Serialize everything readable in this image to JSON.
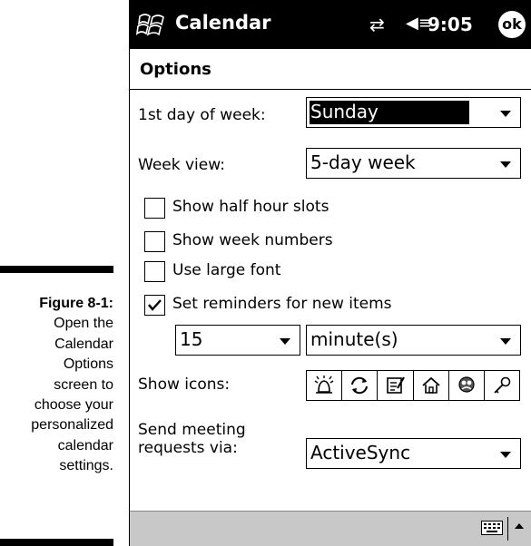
{
  "caption": {
    "figure_label": "Figure 8-1:",
    "lines": [
      "Open the",
      "Calendar",
      "Options",
      "screen to",
      "choose your",
      "personalized",
      "calendar",
      "settings."
    ]
  },
  "titlebar": {
    "app_title": "Calendar",
    "time": "9:05",
    "ok_label": "ok",
    "icons": [
      "windows-start-icon",
      "connectivity-icon",
      "speaker-icon"
    ]
  },
  "page": {
    "title": "Options"
  },
  "fields": {
    "first_day": {
      "label": "1st day of week:",
      "value": "Sunday"
    },
    "week_view": {
      "label": "Week view:",
      "value": "5-day week"
    }
  },
  "checkboxes": [
    {
      "label": "Show half hour slots",
      "checked": false
    },
    {
      "label": "Show week numbers",
      "checked": false
    },
    {
      "label": "Use large font",
      "checked": false
    },
    {
      "label": "Set reminders for new items",
      "checked": true
    }
  ],
  "reminder": {
    "amount": "15",
    "unit": "minute(s)"
  },
  "show_icons": {
    "label": "Show icons:",
    "icons": [
      "alarm-icon",
      "recurrence-icon",
      "note-icon",
      "home-icon",
      "meeting-icon",
      "key-icon"
    ]
  },
  "send_via": {
    "label_line1": "Send meeting",
    "label_line2": "requests via:",
    "value": "ActiveSync"
  },
  "bottombar": {
    "icons": [
      "keyboard-icon",
      "input-arrow-icon"
    ]
  }
}
